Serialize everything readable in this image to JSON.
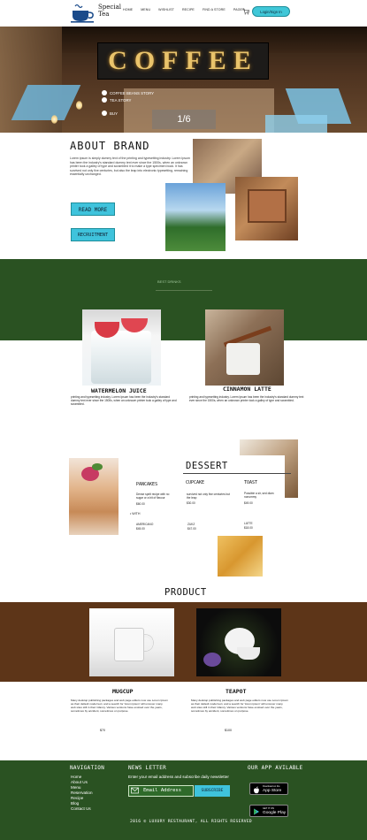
{
  "brand": {
    "line1": "Special",
    "line2": "Tea"
  },
  "nav": [
    "HOME",
    "MENU",
    "WISHLIST",
    "RECIPE",
    "FIND A STORE",
    "PAGES",
    "CONTACT"
  ],
  "cart": {
    "count": "0"
  },
  "login_label": "Login/Sign In",
  "hero": {
    "sign": "COFFEE",
    "links": [
      "COFFEE BEANS STORY",
      "TEA STORY",
      "BUY"
    ],
    "counter": "1/6"
  },
  "about": {
    "title": "ABOUT BRAND",
    "body": "Lorem ipsum is simply dummy text of the printing and typesetting industry. Lorem Ipsum has been the industry's standard dummy text ever since the 1500s, when an unknown printer took a galley of type and scrambled it to make a type specimen book. It has survived not only five centuries, but also the leap into electronic typesetting, remaining essentially unchanged.",
    "read_more": "READ MORE",
    "recruitment": "RECRUITMENT"
  },
  "drinks": {
    "heading": "BEST DRINKS",
    "items": [
      {
        "title": "WATERMELON JUICE",
        "desc": "printing and typesetting industry. Lorem Ipsum has been the industry's standard dummy text ever since the 1500s, when an unknown printer took a galley of type and scrambled."
      },
      {
        "title": "CINNAMON LATTE",
        "desc": "printing and typesetting industry. Lorem Ipsum has been the industry's standard dummy text ever since the 1500s, when an unknown printer took a galley of type and scrambled."
      }
    ]
  },
  "dessert": {
    "title": "DESSERT",
    "pancakes": {
      "title": "PANCAKES",
      "desc": "Dense spelt recipe with no sugar or a bit of flavour",
      "price": "$60.00"
    },
    "with": "• WITH",
    "americano": {
      "title": "AMERICANO",
      "price": "$45.00"
    },
    "cupcake": {
      "title": "CUPCAKE",
      "desc": "survived not only five centuries but the leap",
      "price": "$30.00"
    },
    "zukz": {
      "title": "ZUKZ",
      "price": "$47.00"
    },
    "toast": {
      "title": "TOAST",
      "desc": "Possible a sir, sed diam nonummy",
      "price": "$49.00"
    },
    "latte": {
      "title": "LATTE",
      "price": "$18.00"
    }
  },
  "product": {
    "title": "PRODUCT",
    "items": [
      {
        "title": "MUGCUP",
        "desc": "Many desktop publishing packages and web page editors now use Lorem Ipsum as their default model text, and a search for 'lorem ipsum' will uncover many web sites still in their infancy. Various versions have evolved over the years, sometimes by accident, sometimes on purpose.",
        "price": "$70"
      },
      {
        "title": "TEAPOT",
        "desc": "Many desktop publishing packages and web page editors now use Lorem Ipsum as their default model text, and a search for 'lorem ipsum' will uncover many web sites still in their infancy. Various versions have evolved over the years, sometimes by accident, sometimes on purpose.",
        "price": "$100"
      }
    ]
  },
  "footer": {
    "nav_title": "NAVIGATION",
    "nav_links": [
      "Home",
      "About Us",
      "Menu",
      "Reservation",
      "Recipe",
      "Blog",
      "Contact Us"
    ],
    "news_title": "NEWS LETTER",
    "news_desc": "Enter your email address and subscribe daily newsletter",
    "email_placeholder": "Email Address",
    "subscribe": "SUBSCRIBE",
    "app_title": "OUR APP AVILABLE",
    "app_store": {
      "small": "Download on the",
      "big": "App Store"
    },
    "google_play": {
      "small": "GET IT ON",
      "big": "Google Play"
    },
    "copyright": "2016 © LUXURY RESTAURANT, ALL RIGHTS RESERVED"
  },
  "colors": {
    "accent": "#3fc3dc",
    "green": "#2a5222",
    "brown": "#5d3518"
  }
}
